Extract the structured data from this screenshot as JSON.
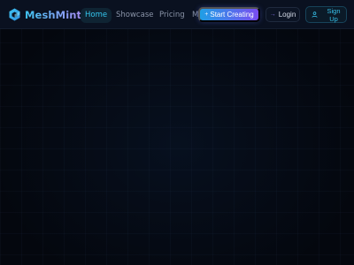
{
  "brand": {
    "name": "MeshMint",
    "icon": "cube-logo-icon"
  },
  "nav": {
    "items": [
      {
        "label": "Home",
        "active": true
      },
      {
        "label": "Showcase",
        "active": false
      },
      {
        "label": "Pricing",
        "active": false
      },
      {
        "label": "M",
        "active": false
      }
    ]
  },
  "actions": {
    "create_label": "Start Creating",
    "create_icon": "plus-icon",
    "login_label": "Login",
    "login_icon": "arrow-icon",
    "signup_label_line1": "Sign",
    "signup_label_line2": "Up",
    "signup_icon": "user-icon"
  },
  "colors": {
    "background": "#050912",
    "navbar": "#0a1120",
    "accent_cyan": "#34c6ee",
    "accent_purple": "#7a4cf0"
  }
}
